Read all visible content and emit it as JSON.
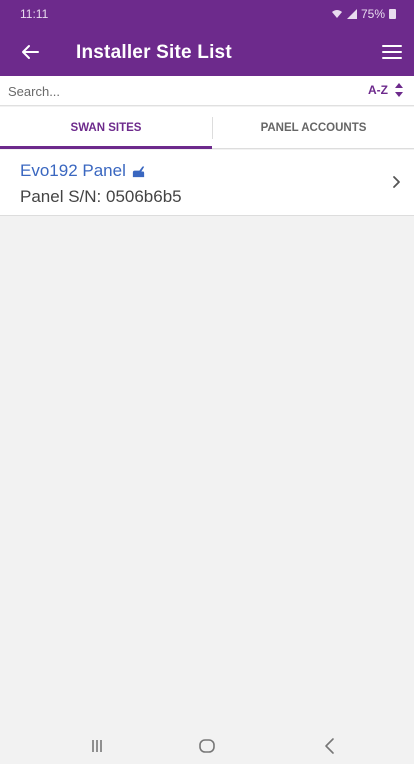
{
  "status_bar": {
    "time": "11:11",
    "battery": "75%"
  },
  "app_bar": {
    "title": "Installer Site List",
    "color": "#6d2a8c"
  },
  "search": {
    "placeholder": "Search...",
    "value": ""
  },
  "sort": {
    "label": "A-Z"
  },
  "tabs": [
    {
      "label": "SWAN SITES",
      "active": true
    },
    {
      "label": "PANEL ACCOUNTS",
      "active": false
    }
  ],
  "sites": [
    {
      "name": "Evo192 Panel",
      "serial": "Panel S/N: 0506b6b5"
    }
  ],
  "icons": {
    "back": "arrow-left-icon",
    "menu": "hamburger-menu-icon",
    "sort": "sort-up-down-icon",
    "site_badge": "installer-hand-icon",
    "chevron": "chevron-right-icon",
    "nav": [
      "recents-icon",
      "home-icon",
      "back-icon"
    ]
  }
}
